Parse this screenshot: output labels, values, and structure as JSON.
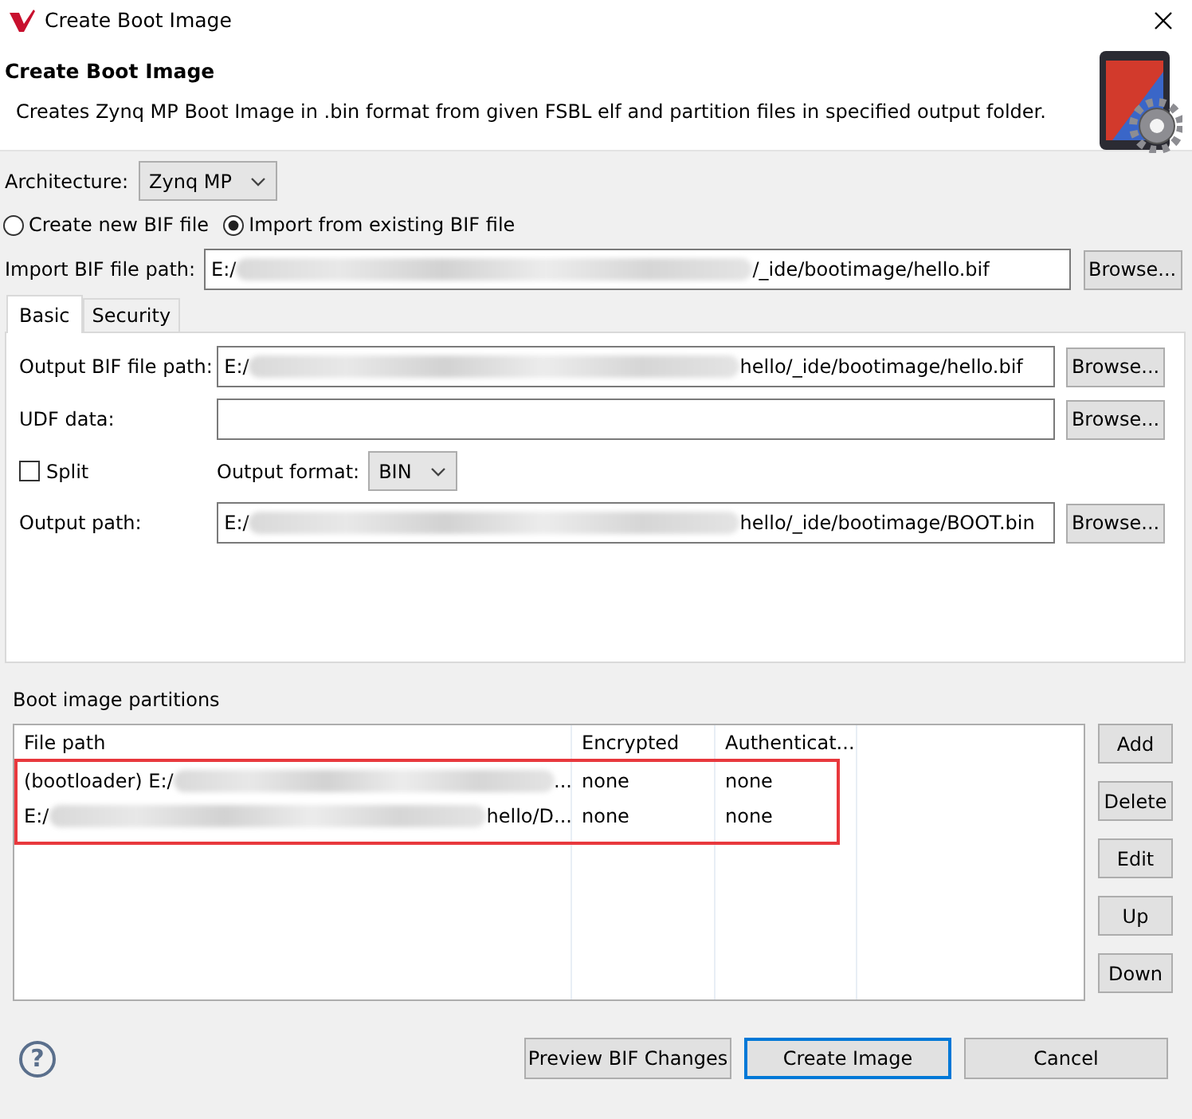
{
  "window": {
    "title": "Create Boot Image"
  },
  "header": {
    "title": "Create Boot Image",
    "description": "Creates Zynq MP Boot Image in .bin format from given FSBL elf and partition files in specified output folder."
  },
  "architecture": {
    "label": "Architecture:",
    "value": "Zynq MP"
  },
  "bif_mode": [
    {
      "label": "Create new BIF file",
      "selected": false
    },
    {
      "label": "Import from existing BIF file",
      "selected": true
    }
  ],
  "import_path": {
    "label": "Import BIF file path:",
    "value_start": "E:/",
    "value_end": "/_ide/bootimage/hello.bif",
    "button": "Browse..."
  },
  "tabs": [
    {
      "label": "Basic",
      "selected": true
    },
    {
      "label": "Security",
      "selected": false
    }
  ],
  "basic": {
    "output_bif": {
      "label": "Output BIF file path:",
      "value_start": "E:/",
      "value_end": "hello/_ide/bootimage/hello.bif",
      "button": "Browse..."
    },
    "udf": {
      "label": "UDF data:",
      "button": "Browse..."
    },
    "split": {
      "label": "Split",
      "checked": false
    },
    "output_format": {
      "label": "Output format:",
      "value": "BIN"
    },
    "output_path": {
      "label": "Output path:",
      "value_start": "E:/",
      "value_end": "hello/_ide/bootimage/BOOT.bin",
      "button": "Browse..."
    }
  },
  "partitions": {
    "title": "Boot image partitions",
    "columns": [
      "File path",
      "Encrypted",
      "Authenticat..."
    ],
    "rows": [
      {
        "file_path_start": "(bootloader) E:/",
        "file_path_end": "...",
        "encrypted": "none",
        "authentication": "none"
      },
      {
        "file_path_start": "E:/",
        "file_path_end": "hello/D...",
        "encrypted": "none",
        "authentication": "none"
      }
    ],
    "buttons": [
      "Add",
      "Delete",
      "Edit",
      "Up",
      "Down"
    ]
  },
  "footer": {
    "help": "?",
    "buttons": [
      {
        "label": "Preview BIF Changes",
        "default": false
      },
      {
        "label": "Create Image",
        "default": true
      },
      {
        "label": "Cancel",
        "default": false
      }
    ]
  }
}
